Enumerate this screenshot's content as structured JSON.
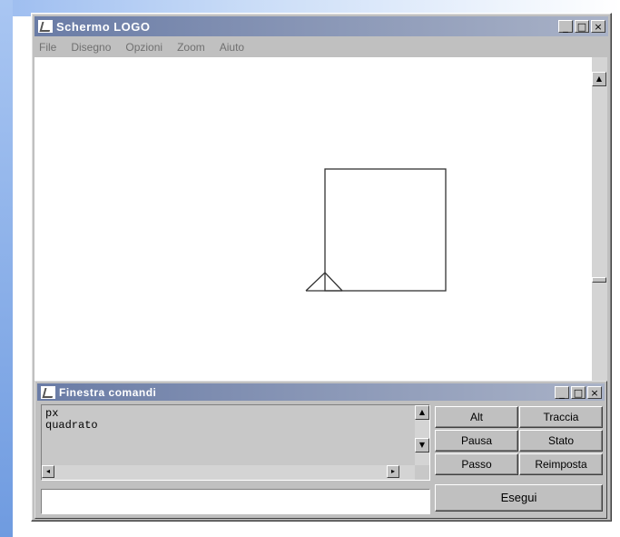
{
  "main_window": {
    "title": "Schermo LOGO",
    "minimize": "_",
    "maximize": "□",
    "close": "×"
  },
  "menu": {
    "items": [
      "File",
      "Disegno",
      "Opzioni",
      "Zoom",
      "Aiuto"
    ]
  },
  "command_window": {
    "title": "Finestra comandi",
    "minimize": "_",
    "maximize": "□",
    "close": "×",
    "history_text": "px\nquadrato",
    "input_value": "",
    "buttons": {
      "alt": "Alt",
      "traccia": "Traccia",
      "pausa": "Pausa",
      "stato": "Stato",
      "passo": "Passo",
      "reimposta": "Reimposta",
      "esegui": "Esegui"
    }
  },
  "icons": {
    "app": "logo-turtle-icon",
    "scroll_up": "arrow-up-icon",
    "scroll_down": "arrow-down-icon",
    "scroll_left": "arrow-left-icon",
    "scroll_right": "arrow-right-icon"
  },
  "colors": {
    "titlebar": "#6a7ca6",
    "window_face": "#c0c0c0",
    "canvas": "#ffffff",
    "drawing": "#333333"
  }
}
